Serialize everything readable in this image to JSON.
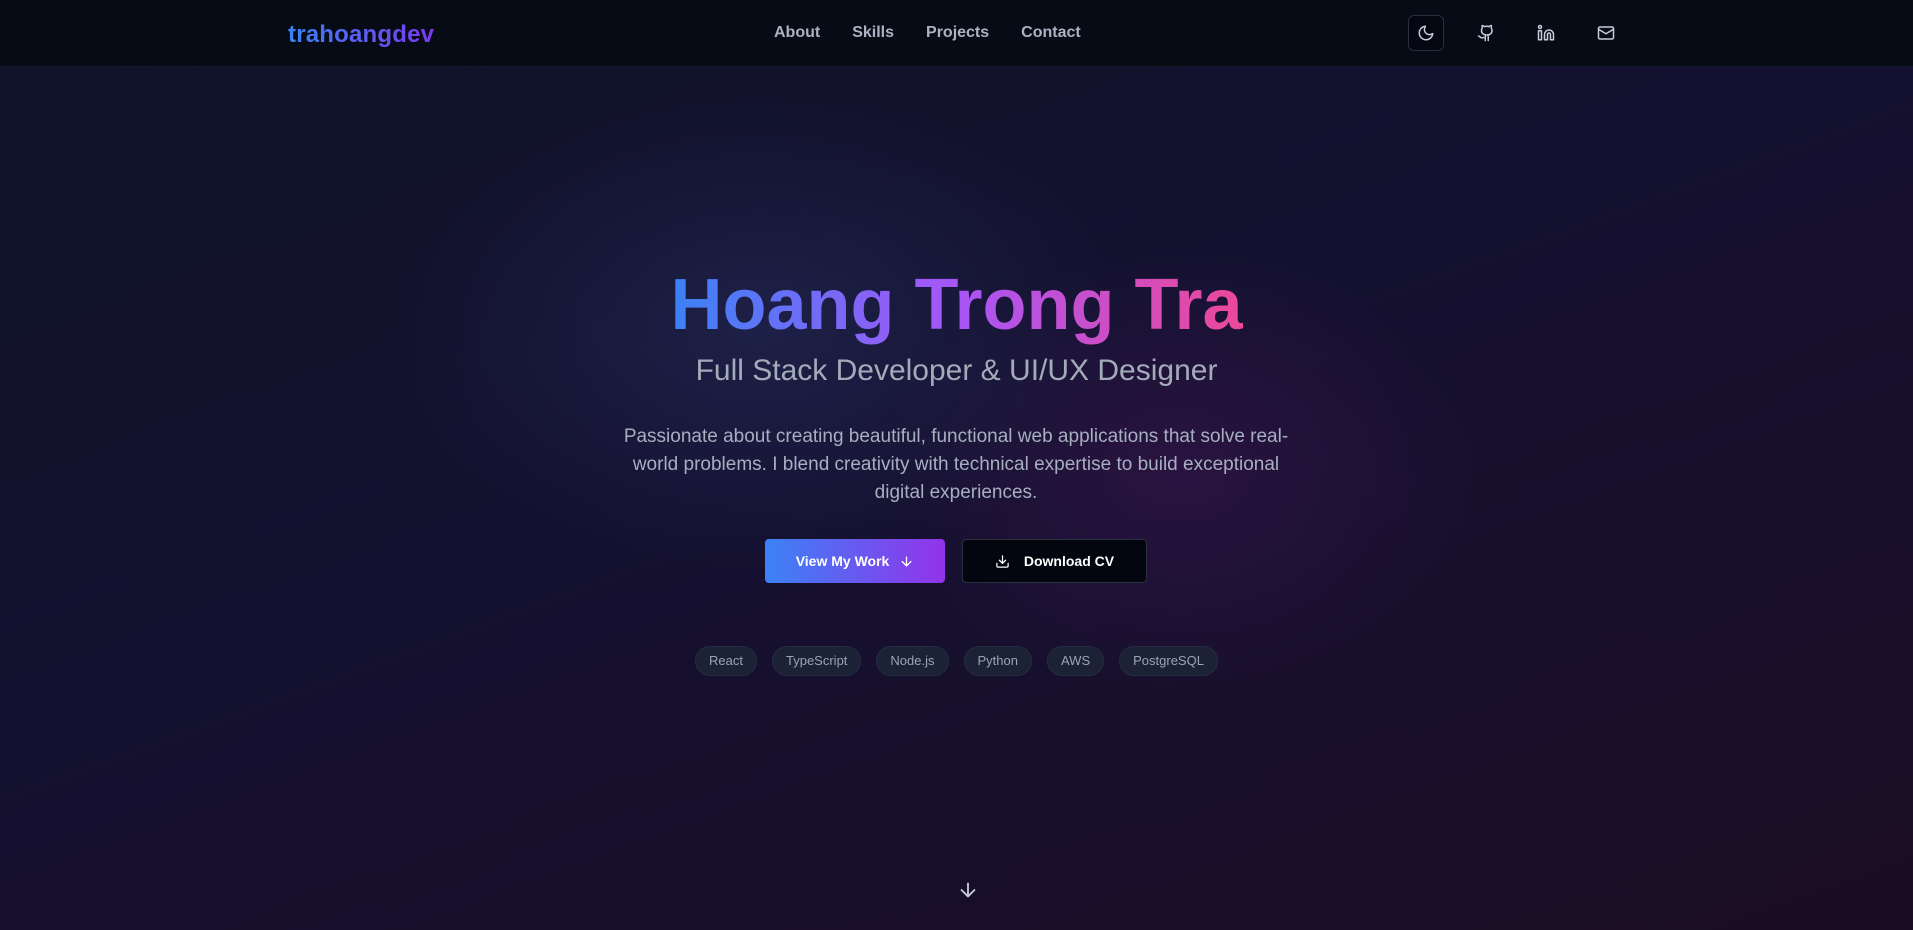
{
  "header": {
    "logo": "trahoangdev",
    "nav": [
      "About",
      "Skills",
      "Projects",
      "Contact"
    ],
    "icons": [
      "moon-icon",
      "github-icon",
      "linkedin-icon",
      "mail-icon"
    ]
  },
  "hero": {
    "title": "Hoang Trong Tra",
    "subtitle": "Full Stack Developer & UI/UX Designer",
    "description": "Passionate about creating beautiful, functional web applications that solve real-world problems. I blend creativity with technical expertise to build exceptional digital experiences.",
    "primary_button": "View My Work",
    "secondary_button": "Download CV",
    "tags": [
      "React",
      "TypeScript",
      "Node.js",
      "Python",
      "AWS",
      "PostgreSQL"
    ]
  },
  "colors": {
    "accent_blue": "#3b82f6",
    "accent_purple": "#a855f7",
    "accent_pink": "#ec4899",
    "header_bg": "#070b16"
  }
}
